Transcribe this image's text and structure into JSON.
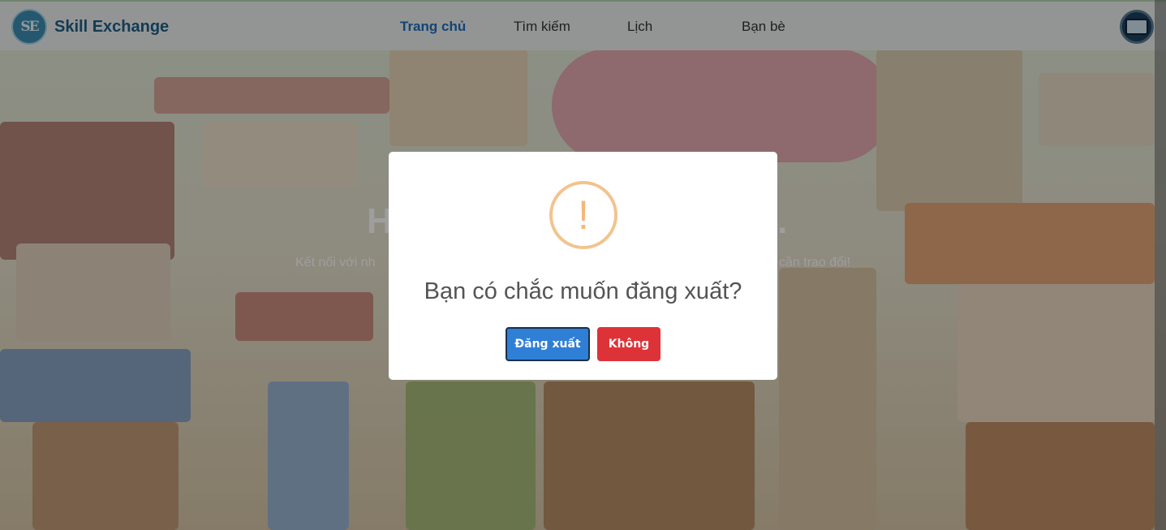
{
  "brand": {
    "logo_text": "SE",
    "name": "Skill Exchange"
  },
  "nav": {
    "items": [
      {
        "label": "Trang chủ",
        "active": true
      },
      {
        "label": "Tìm kiếm",
        "active": false
      },
      {
        "label": "Lịch",
        "active": false
      },
      {
        "label": "Bạn bè",
        "active": false
      }
    ]
  },
  "hero": {
    "title_start": "H",
    "title_end": ".",
    "subtitle_start": "Kết nối với nh",
    "subtitle_end": "cần trao đổi!"
  },
  "modal": {
    "icon": "warning-icon",
    "icon_glyph": "!",
    "title": "Bạn có chắc muốn đăng xuất?",
    "confirm_label": "Đăng xuất",
    "cancel_label": "Không"
  },
  "colors": {
    "brand": "#1f5f86",
    "nav_active": "#1f6ec0",
    "confirm": "#2f7fd6",
    "cancel": "#dd3338",
    "warning": "#f3c38e"
  }
}
